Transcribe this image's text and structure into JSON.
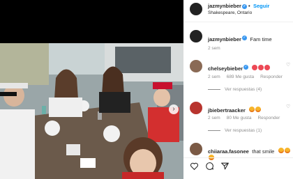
{
  "post": {
    "username": "jazmynbieber",
    "location": "Shakespeare, Ontario",
    "follow_label": "Seguir",
    "dot": "•",
    "caption": "Fam time",
    "caption_age": "2 sem"
  },
  "comments": [
    {
      "username": "chelseybieber",
      "age": "2 sem",
      "likes": "689 Me gusta",
      "reply_label": "Responder",
      "view_replies": "Ver respuestas (4)"
    },
    {
      "username": "jbiebertraacker",
      "age": "2 sem",
      "likes": "80 Me gusta",
      "reply_label": "Responder",
      "view_replies": "Ver respuestas (1)"
    },
    {
      "username": "chiiaraa.fasonee",
      "text": "that smile"
    }
  ],
  "icons": {
    "verified": "verified-badge-icon",
    "like": "heart-icon",
    "comment": "comment-icon",
    "share": "share-icon",
    "next": "chevron-right-icon"
  },
  "colors": {
    "accent": "#0095f6",
    "verified": "#3897f0",
    "heart": "#ed4956",
    "muted": "#8e8e8e"
  }
}
